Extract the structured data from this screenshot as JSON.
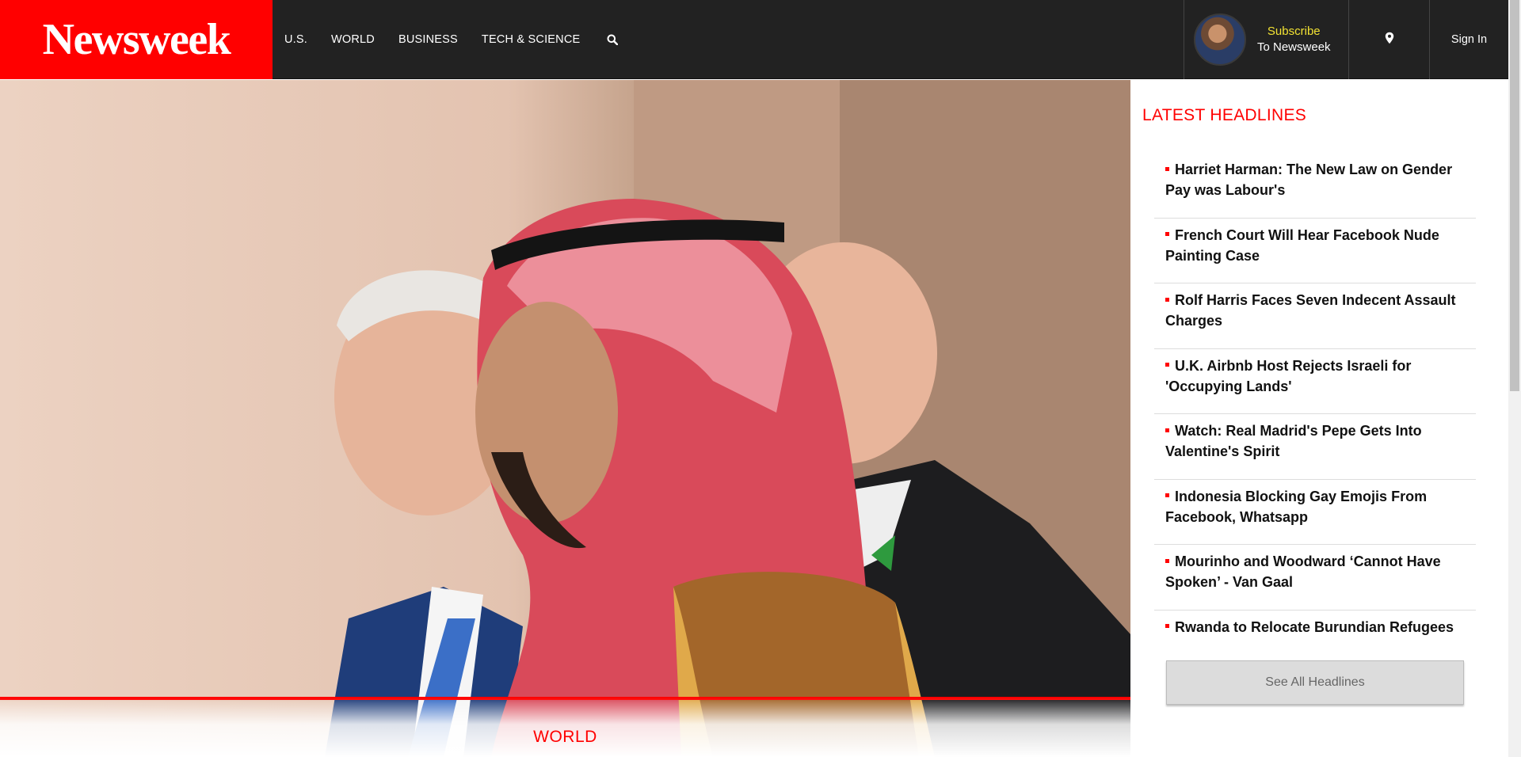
{
  "header": {
    "logo_text": "Newsweek",
    "nav": [
      {
        "label": "U.S."
      },
      {
        "label": "WORLD"
      },
      {
        "label": "BUSINESS"
      },
      {
        "label": "TECH & SCIENCE"
      }
    ],
    "search_icon": "search-icon",
    "subscribe_top": "Subscribe",
    "subscribe_bottom": "To Newsweek",
    "location_icon": "map-pin-icon",
    "sign_in": "Sign In"
  },
  "hero": {
    "category": "WORLD"
  },
  "sidebar": {
    "title": "LATEST HEADLINES",
    "headlines": [
      {
        "text": "Harriet Harman: The New Law on Gender Pay was Labour's"
      },
      {
        "text": "French Court Will Hear Facebook Nude Painting Case"
      },
      {
        "text": "Rolf Harris Faces Seven Indecent Assault Charges"
      },
      {
        "text": "U.K. Airbnb Host Rejects Israeli for 'Occupying Lands'"
      },
      {
        "text": "Watch: Real Madrid's Pepe Gets Into Valentine's Spirit"
      },
      {
        "text": "Indonesia Blocking Gay Emojis From Facebook, Whatsapp"
      },
      {
        "text": "Mourinho and Woodward ‘Cannot Have Spoken’ - Van Gaal"
      },
      {
        "text": "Rwanda to Relocate Burundian Refugees"
      }
    ],
    "see_all": "See All Headlines"
  },
  "colors": {
    "brand_red": "#ff0000",
    "header_bg": "#222222",
    "subscribe_yellow": "#f2e233"
  }
}
